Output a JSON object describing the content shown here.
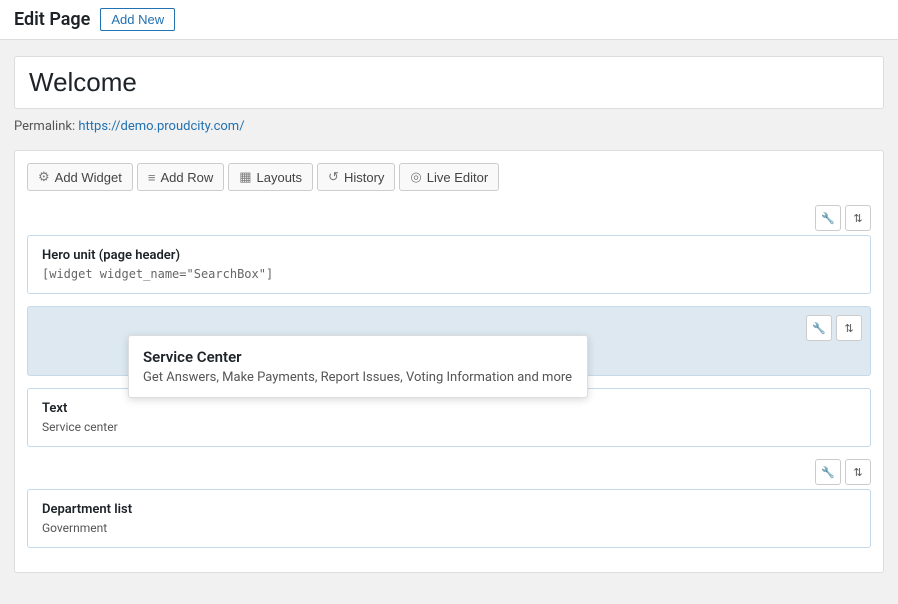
{
  "topbar": {
    "title": "Edit Page",
    "add_new_label": "Add New"
  },
  "page": {
    "title_value": "Welcome",
    "permalink_label": "Permalink:",
    "permalink_url": "https://demo.proudcity.com/",
    "permalink_display": "https://demo.proudcity.com/"
  },
  "toolbar": {
    "add_widget_label": "Add Widget",
    "add_row_label": "Add Row",
    "layouts_label": "Layouts",
    "history_label": "History",
    "live_editor_label": "Live Editor"
  },
  "sections": [
    {
      "id": "hero-unit",
      "type": "widget",
      "title": "Hero unit (page header)",
      "content": "[widget widget_name=\"SearchBox\"]"
    },
    {
      "id": "service-center-row",
      "type": "row",
      "tooltip": {
        "title": "Service Center",
        "description": "Get Answers, Make Payments, Report Issues, Voting Information and more"
      }
    },
    {
      "id": "text-widget",
      "type": "widget",
      "title": "Text",
      "content": "Service center"
    },
    {
      "id": "department-list",
      "type": "widget",
      "title": "Department list",
      "content": "Government"
    }
  ],
  "icons": {
    "wrench": "🔧",
    "move": "⇅",
    "gear": "⚙",
    "rows": "≡",
    "layout": "▦",
    "history": "↺",
    "eye": "◎"
  }
}
